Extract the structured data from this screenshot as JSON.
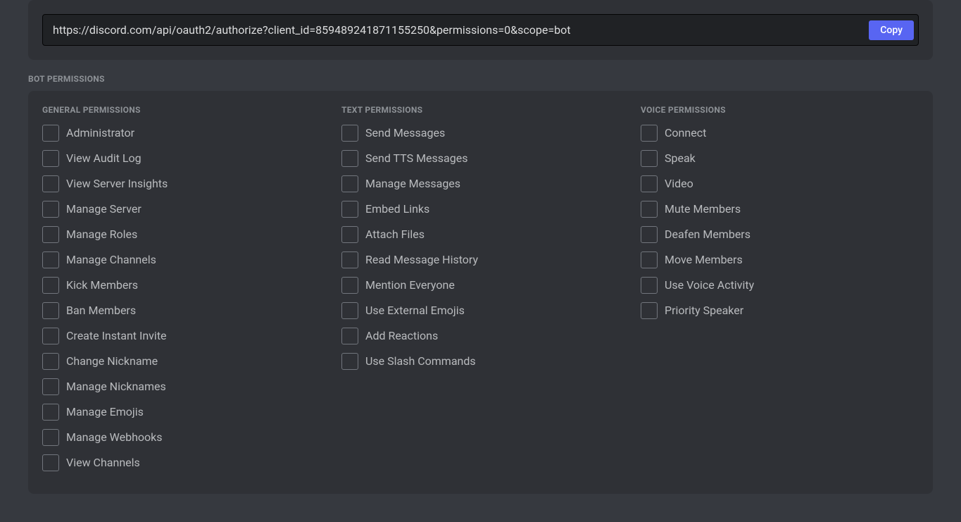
{
  "url_section": {
    "url_value": "https://discord.com/api/oauth2/authorize?client_id=859489241871155250&permissions=0&scope=bot",
    "copy_label": "Copy"
  },
  "permissions": {
    "section_label": "BOT PERMISSIONS",
    "columns": [
      {
        "header": "GENERAL PERMISSIONS",
        "items": [
          "Administrator",
          "View Audit Log",
          "View Server Insights",
          "Manage Server",
          "Manage Roles",
          "Manage Channels",
          "Kick Members",
          "Ban Members",
          "Create Instant Invite",
          "Change Nickname",
          "Manage Nicknames",
          "Manage Emojis",
          "Manage Webhooks",
          "View Channels"
        ]
      },
      {
        "header": "TEXT PERMISSIONS",
        "items": [
          "Send Messages",
          "Send TTS Messages",
          "Manage Messages",
          "Embed Links",
          "Attach Files",
          "Read Message History",
          "Mention Everyone",
          "Use External Emojis",
          "Add Reactions",
          "Use Slash Commands"
        ]
      },
      {
        "header": "VOICE PERMISSIONS",
        "items": [
          "Connect",
          "Speak",
          "Video",
          "Mute Members",
          "Deafen Members",
          "Move Members",
          "Use Voice Activity",
          "Priority Speaker"
        ]
      }
    ]
  }
}
